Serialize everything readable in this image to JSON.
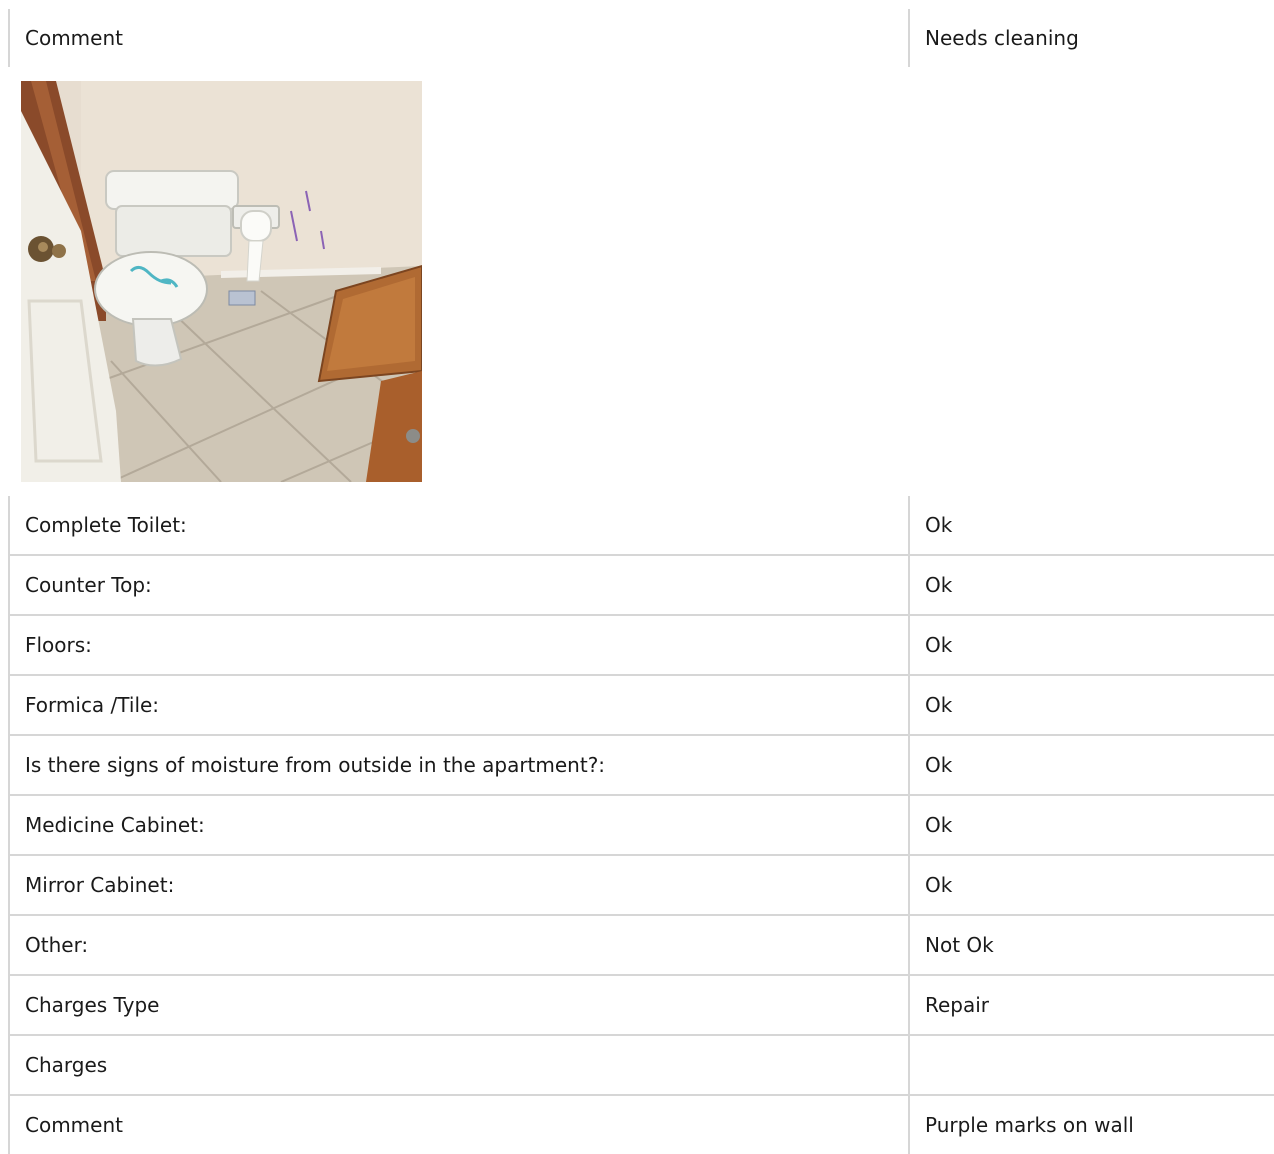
{
  "top_row": {
    "label": "Comment",
    "value": "Needs cleaning"
  },
  "photo": {
    "subject": "bathroom-toilet-photo"
  },
  "rows": [
    {
      "label": "Complete Toilet:",
      "value": "Ok"
    },
    {
      "label": "Counter Top:",
      "value": "Ok"
    },
    {
      "label": "Floors:",
      "value": "Ok"
    },
    {
      "label": "Formica /Tile:",
      "value": "Ok"
    },
    {
      "label": "Is there signs of moisture from outside in the apartment?:",
      "value": "Ok"
    },
    {
      "label": "Medicine Cabinet:",
      "value": "Ok"
    },
    {
      "label": "Mirror Cabinet:",
      "value": "Ok"
    },
    {
      "label": "Other:",
      "value": "Not Ok"
    },
    {
      "label": "Charges Type",
      "value": "Repair"
    },
    {
      "label": "Charges",
      "value": ""
    },
    {
      "label": "Comment",
      "value": "Purple marks on wall"
    }
  ]
}
